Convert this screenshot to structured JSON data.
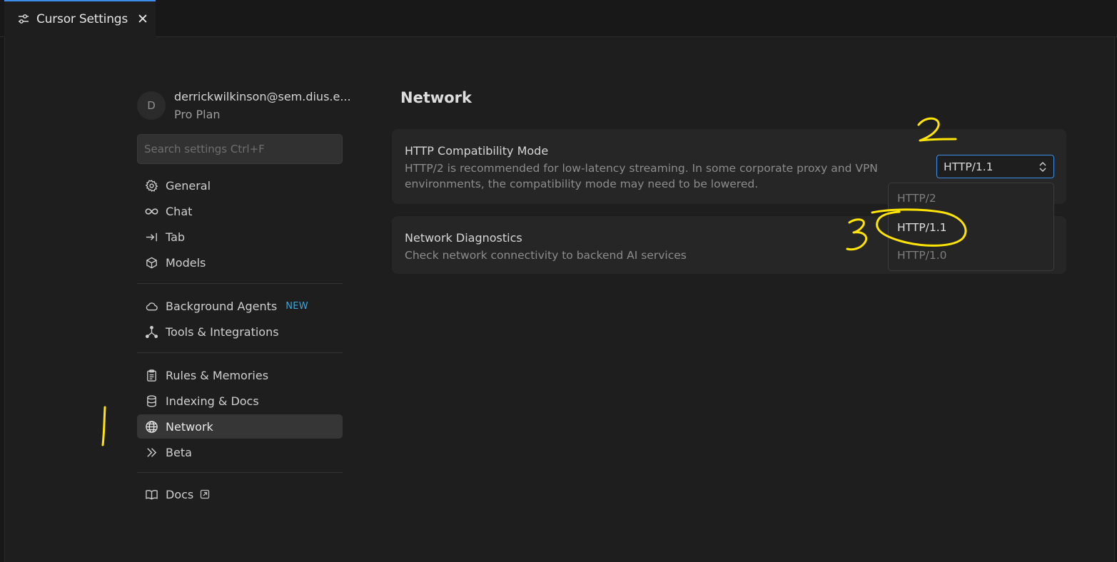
{
  "tab": {
    "title": "Cursor Settings",
    "close": "✕"
  },
  "account": {
    "avatar_initial": "D",
    "email": "derrickwilkinson@sem.dius.e...",
    "plan": "Pro Plan"
  },
  "search": {
    "placeholder": "Search settings Ctrl+F",
    "value": ""
  },
  "sidebar": {
    "items": [
      {
        "label": "General",
        "icon": "gear-icon"
      },
      {
        "label": "Chat",
        "icon": "infinity-icon"
      },
      {
        "label": "Tab",
        "icon": "arrow-right-to-line-icon"
      },
      {
        "label": "Models",
        "icon": "cube-icon"
      },
      {
        "label": "Background Agents",
        "icon": "cloud-icon",
        "badge": "NEW"
      },
      {
        "label": "Tools & Integrations",
        "icon": "nodes-icon"
      },
      {
        "label": "Rules & Memories",
        "icon": "clipboard-icon"
      },
      {
        "label": "Indexing & Docs",
        "icon": "database-icon"
      },
      {
        "label": "Network",
        "icon": "globe-icon",
        "active": true
      },
      {
        "label": "Beta",
        "icon": "double-chevron-right-icon"
      },
      {
        "label": "Docs",
        "icon": "book-icon",
        "external": true
      }
    ]
  },
  "main": {
    "title": "Network",
    "http_mode": {
      "title": "HTTP Compatibility Mode",
      "description": "HTTP/2 is recommended for low-latency streaming. In some corporate proxy and VPN environments, the compatibility mode may need to be lowered.",
      "selected": "HTTP/1.1",
      "options": [
        "HTTP/2",
        "HTTP/1.1",
        "HTTP/1.0"
      ]
    },
    "diagnostics": {
      "title": "Network Diagnostics",
      "description": "Check network connectivity to backend AI services"
    }
  },
  "annotations": {
    "one": "1",
    "two": "2",
    "three": "3",
    "color": "#ffe500"
  },
  "colors": {
    "accent": "#3b8eea",
    "badge": "#3fa6d8",
    "background": "#1e1e1e",
    "card": "#262626"
  }
}
